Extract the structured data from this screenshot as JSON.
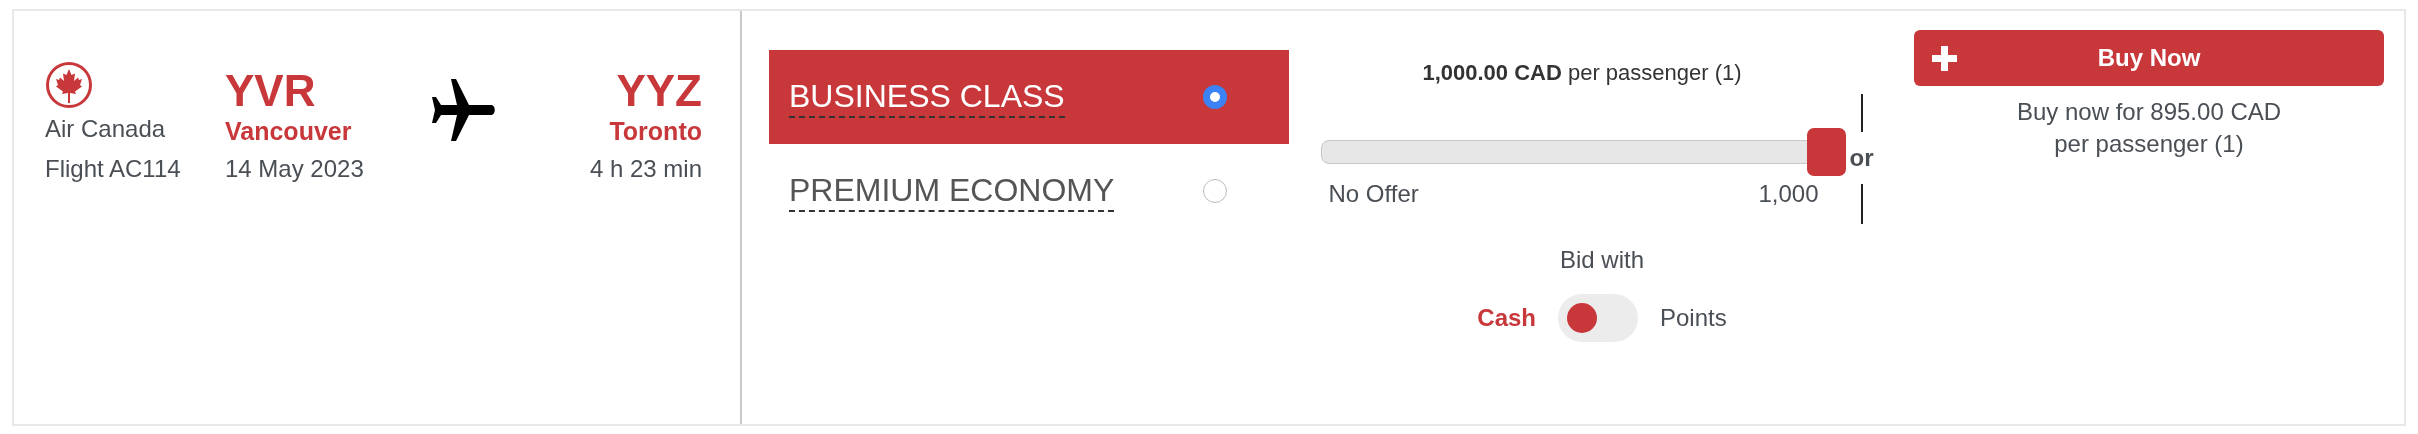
{
  "flight": {
    "airline": "Air Canada",
    "flight_number": "Flight AC114",
    "origin": {
      "code": "YVR",
      "city": "Vancouver",
      "date": "14 May 2023"
    },
    "destination": {
      "code": "YYZ",
      "city": "Toronto",
      "duration": "4 h 23 min"
    }
  },
  "fare_classes": [
    {
      "label": "BUSINESS CLASS",
      "selected": true
    },
    {
      "label": "PREMIUM ECONOMY",
      "selected": false
    }
  ],
  "bid": {
    "price": "**1,000.00 CAD** per passenger (1)",
    "level": 1,
    "min_label": "No Offer",
    "max_label": "1,000",
    "separator": "or",
    "bid_with_label": "Bid with",
    "options": [
      {
        "label": "Cash",
        "selected": true
      },
      {
        "label": "Points",
        "selected": false
      }
    ]
  },
  "buy_now": {
    "button": "Buy Now",
    "description": "Buy now for 895.00 CAD\nper passenger (1)"
  }
}
